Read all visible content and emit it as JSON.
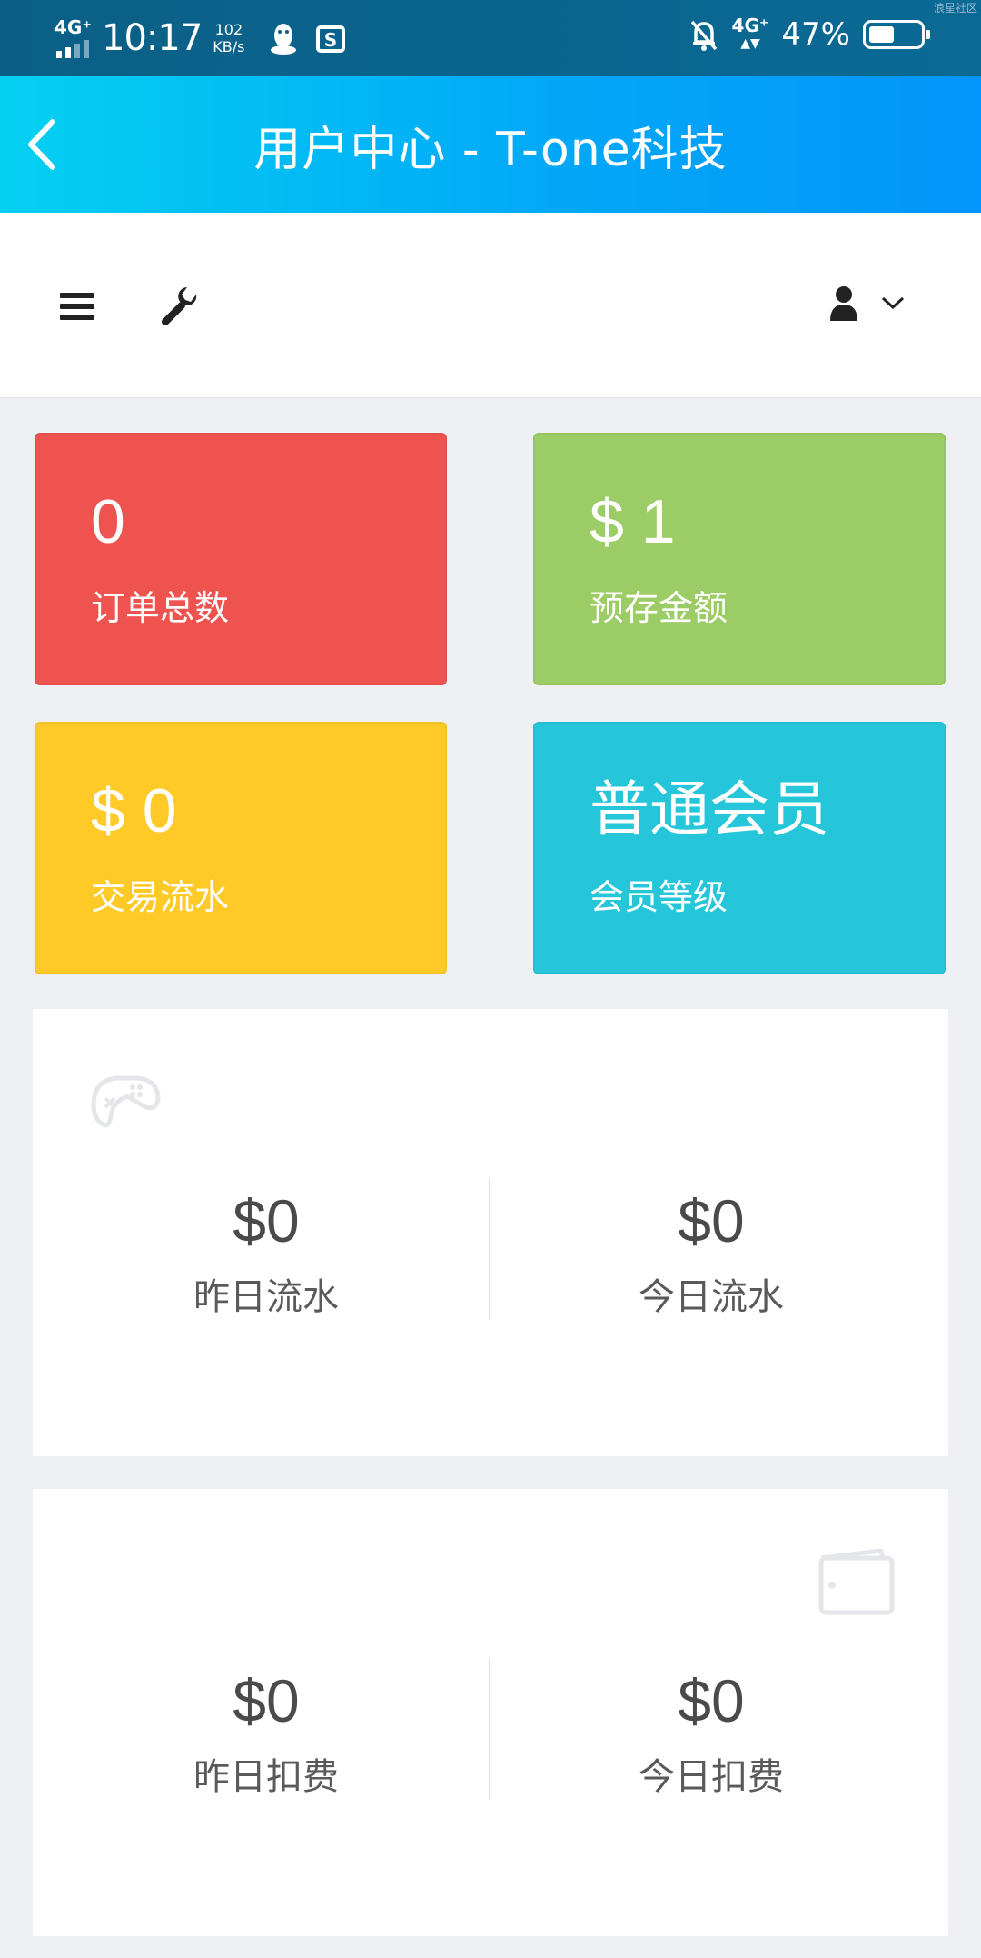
{
  "status_bar": {
    "network_left": "4G⁺",
    "time": "10:17",
    "speed_value": "102",
    "speed_unit": "KB/s",
    "network_right": "4G⁺",
    "battery_percent": "47%",
    "battery_level": 0.47,
    "corner_text": "浪星社区"
  },
  "header": {
    "title": "用户中心 - T-one科技"
  },
  "stats": [
    {
      "value": "0",
      "label": "订单总数",
      "color": "#ef5350"
    },
    {
      "value": "$ 1",
      "label": "预存金额",
      "color": "#9ccc65"
    },
    {
      "value": "$ 0",
      "label": "交易流水",
      "color": "#ffca28"
    },
    {
      "value": "普通会员",
      "label": "会员等级",
      "color": "#26c6da"
    }
  ],
  "flow_panel": {
    "icon": "gamepad-icon",
    "left": {
      "amount": "$0",
      "label": "昨日流水"
    },
    "right": {
      "amount": "$0",
      "label": "今日流水"
    }
  },
  "fee_panel": {
    "icon": "wallet-icon",
    "left": {
      "amount": "$0",
      "label": "昨日扣费"
    },
    "right": {
      "amount": "$0",
      "label": "今日扣费"
    }
  },
  "colors": {
    "title_gradient_start": "#04d0f1",
    "title_gradient_end": "#0295fb",
    "status_bar": "#0b5f86"
  }
}
